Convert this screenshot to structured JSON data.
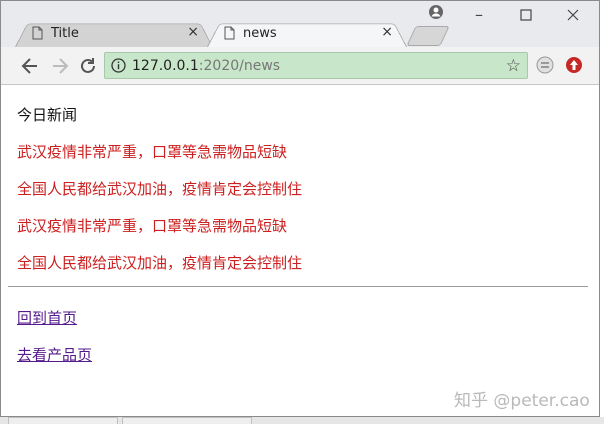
{
  "browser": {
    "tabs": [
      {
        "title": "Title",
        "active": false
      },
      {
        "title": "news",
        "active": true
      }
    ],
    "close_glyph": "×",
    "window_controls": {
      "minimize": "–",
      "maximize": "☐",
      "close": "✕"
    },
    "address": {
      "host": "127.0.0.1",
      "rest": ":2020/news"
    },
    "icons": {
      "back": "back-arrow-icon",
      "forward": "forward-arrow-icon",
      "reload": "reload-icon",
      "info": "info-icon",
      "bookmark": "star-icon",
      "extension1": "extension-icon",
      "extension2": "red-up-arrow-icon",
      "profile": "profile-icon"
    },
    "colors": {
      "omnibox_bg": "#c8e6c9",
      "news_text": "#cc2020",
      "link": "#551a8b"
    }
  },
  "page": {
    "heading": "今日新闻",
    "news_items": [
      "武汉疫情非常严重，口罩等急需物品短缺",
      "全国人民都给武汉加油，疫情肯定会控制住",
      "武汉疫情非常严重，口罩等急需物品短缺",
      "全国人民都给武汉加油，疫情肯定会控制住"
    ],
    "links": [
      "回到首页",
      "去看产品页"
    ]
  },
  "watermark": "知乎 @peter.cao"
}
